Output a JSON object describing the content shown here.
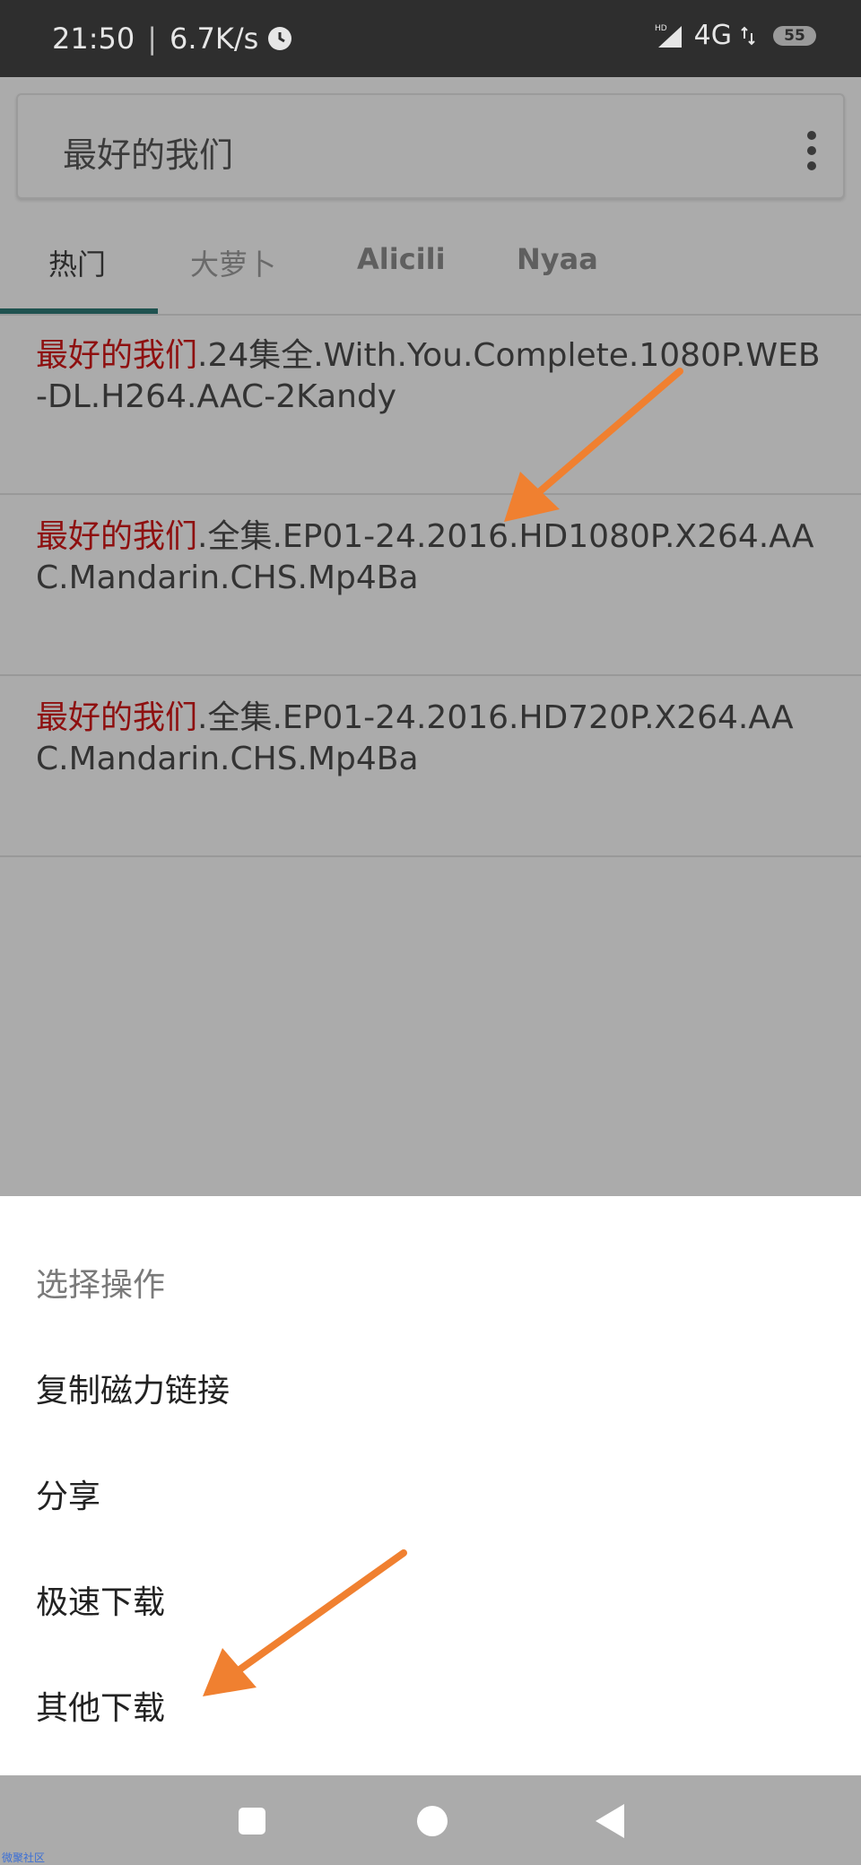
{
  "status_bar": {
    "time": "21:50",
    "separator": "|",
    "speed": "6.7K/s",
    "hd": "HD",
    "network": "4G",
    "battery": "55"
  },
  "search": {
    "query": "最好的我们",
    "more_icon": "kebab-menu-icon"
  },
  "tabs": [
    {
      "label": "热门",
      "active": true
    },
    {
      "label": "大萝卜",
      "active": false
    },
    {
      "label": "Alicili",
      "active": false
    },
    {
      "label": "Nyaa",
      "active": false
    }
  ],
  "results": [
    {
      "highlight": "最好的我们",
      "rest": ".24集全.With.You.Complete.1080P.WEB-DL.H264.AAC-2Kandy"
    },
    {
      "highlight": "最好的我们",
      "rest": ".全集.EP01-24.2016.HD1080P.X264.AAC.Mandarin.CHS.Mp4Ba"
    },
    {
      "highlight": "最好的我们",
      "rest": ".全集.EP01-24.2016.HD720P.X264.AAC.Mandarin.CHS.Mp4Ba"
    }
  ],
  "sheet": {
    "title": "选择操作",
    "items": [
      "复制磁力链接",
      "分享",
      "极速下载",
      "其他下载"
    ]
  },
  "nav": {
    "recent": "square-icon",
    "home": "circle-icon",
    "back": "triangle-back-icon"
  },
  "watermark": "微聚社区",
  "colors": {
    "highlight": "#8e1010",
    "arrow": "#f08030",
    "tab_indicator": "#1f5250"
  }
}
